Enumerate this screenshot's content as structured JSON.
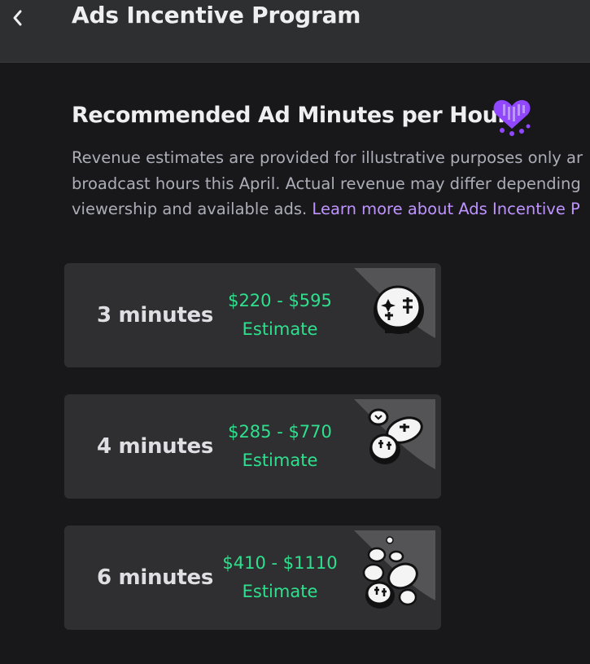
{
  "header": {
    "back_icon": "chevron-left-icon",
    "title": "Ads Incentive Program"
  },
  "section": {
    "title": "Recommended Ad Minutes per Hour",
    "icon": "purple-heart-icon",
    "description_lines": [
      "Revenue estimates are provided for illustrative purposes only ar",
      "broadcast hours this April. Actual revenue may differ depending",
      "viewership and available ads. "
    ],
    "link_text": "Learn more about Ads Incentive P"
  },
  "cards": [
    {
      "minutes": "3 minutes",
      "range": "$220 - $595",
      "estimate_label": "Estimate",
      "icon": "single-coin-icon"
    },
    {
      "minutes": "4 minutes",
      "range": "$285 - $770",
      "estimate_label": "Estimate",
      "icon": "coin-stack-icon"
    },
    {
      "minutes": "6 minutes",
      "range": "$410 - $1110",
      "estimate_label": "Estimate",
      "icon": "coin-pile-icon"
    }
  ],
  "colors": {
    "background": "#18181b",
    "header": "#2e2f31",
    "card": "#2f2f32",
    "accent_purple": "#bf94ff",
    "estimate_green": "#2ee08d"
  }
}
